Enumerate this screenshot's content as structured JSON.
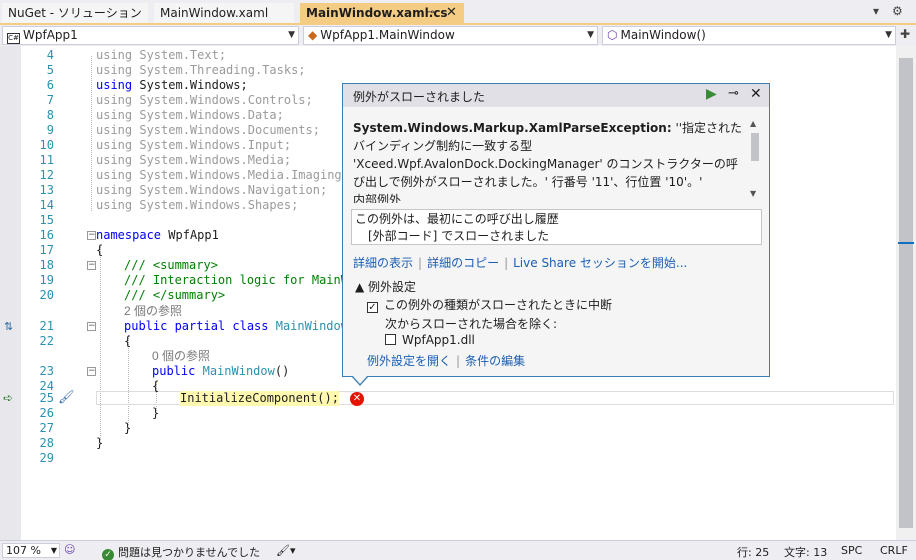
{
  "tabs": [
    {
      "label": "NuGet - ソリューション"
    },
    {
      "label": "MainWindow.xaml"
    },
    {
      "label": "MainWindow.xaml.cs",
      "active": true,
      "pin_icon": "pin-icon",
      "close_icon": "close-icon"
    }
  ],
  "tab_controls": {
    "dropdown_icon": "chevron-down-icon",
    "settings_icon": "gear-icon"
  },
  "navbar": {
    "project": "WpfApp1",
    "type": "WpfApp1.MainWindow",
    "member": "MainWindow()"
  },
  "code": {
    "line_numbers": [
      "4",
      "5",
      "6",
      "7",
      "8",
      "9",
      "10",
      "11",
      "12",
      "13",
      "14",
      "15",
      "16",
      "17",
      "18",
      "19",
      "20",
      "21",
      "22",
      "23",
      "24",
      "25",
      "26",
      "27",
      "28",
      "29"
    ],
    "usings": [
      "System.Text;",
      "System.Threading.Tasks;",
      "System.Windows;",
      "System.Windows.Controls;",
      "System.Windows.Data;",
      "System.Windows.Documents;",
      "System.Windows.Input;",
      "System.Windows.Media;",
      "System.Windows.Media.Imaging;",
      "System.Windows.Navigation;",
      "System.Windows.Shapes;"
    ],
    "kw_using": "using",
    "kw_namespace": "namespace",
    "namespace_name": "WpfApp1",
    "open_brace": "{",
    "close_brace": "}",
    "doc_summary_open": "/// <summary>",
    "doc_summary_text": "/// Interaction logic for MainW",
    "doc_summary_close": "/// </summary>",
    "refs_class": "2 個の参照",
    "class_decl_kw": "public partial class",
    "class_name": "MainWindow",
    "refs_ctor": "0 個の参照",
    "ctor_kw": "public",
    "ctor_name": "MainWindow",
    "ctor_parens": "()",
    "call": "InitializeComponent();"
  },
  "popup": {
    "title": "例外がスローされました",
    "continue_icon": "play-icon",
    "pin_icon": "pin-icon",
    "close_icon": "close-icon",
    "exception_type": "System.Windows.Markup.XamlParseException:",
    "message": " ''指定されたバインディング制約に一致する型 'Xceed.Wpf.AvalonDock.DockingManager' のコンストラクターの呼び出しで例外がスローされました。' 行番号 '11'、行位置 '10'。'",
    "inner_exception_label": "内部例外",
    "stack_line1": "この例外は、最初にこの呼び出し履歴",
    "stack_line2": "[外部コード] でスローされました",
    "link_details": "詳細の表示",
    "link_copy": "詳細のコピー",
    "link_liveshare": "Live Share セッションを開始...",
    "exception_settings_title": "▲ 例外設定",
    "break_when_thrown": "この例外の種類がスローされたときに中断",
    "break_when_thrown_checked": true,
    "except_when": "次からスローされた場合を除く:",
    "module": "WpfApp1.dll",
    "module_checked": false,
    "link_open_settings": "例外設定を開く",
    "link_edit_conditions": "条件の編集"
  },
  "status": {
    "zoom": "107 %",
    "issues": "問題は見つかりませんでした",
    "line": "行: 25",
    "col": "文字: 13",
    "spc": "SPC",
    "crlf": "CRLF"
  }
}
